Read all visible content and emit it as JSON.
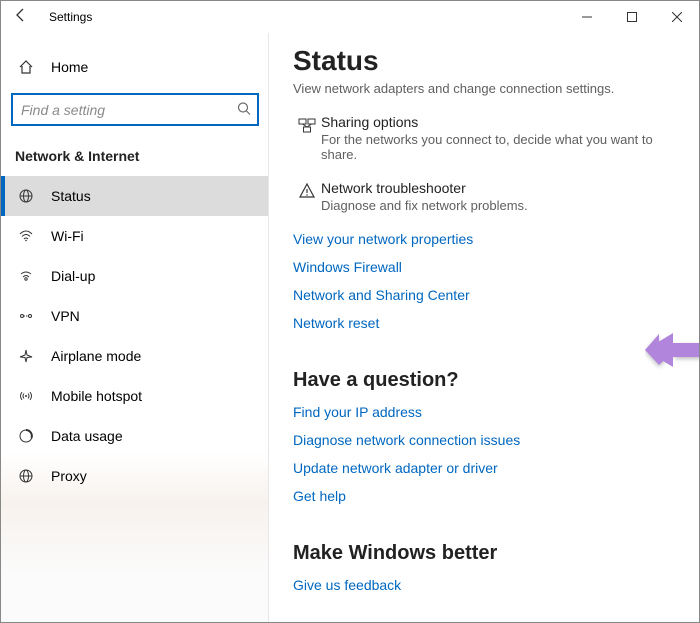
{
  "window": {
    "title": "Settings"
  },
  "sidebar": {
    "home": "Home",
    "search_placeholder": "Find a setting",
    "section": "Network & Internet",
    "items": [
      {
        "label": "Status"
      },
      {
        "label": "Wi-Fi"
      },
      {
        "label": "Dial-up"
      },
      {
        "label": "VPN"
      },
      {
        "label": "Airplane mode"
      },
      {
        "label": "Mobile hotspot"
      },
      {
        "label": "Data usage"
      },
      {
        "label": "Proxy"
      }
    ]
  },
  "content": {
    "title": "Status",
    "faded_line": "View network adapters and change connection settings.",
    "items": [
      {
        "title": "Sharing options",
        "desc": "For the networks you connect to, decide what you want to share."
      },
      {
        "title": "Network troubleshooter",
        "desc": "Diagnose and fix network problems."
      }
    ],
    "links": [
      "View your network properties",
      "Windows Firewall",
      "Network and Sharing Center",
      "Network reset"
    ],
    "question_hdr": "Have a question?",
    "question_links": [
      "Find your IP address",
      "Diagnose network connection issues",
      "Update network adapter or driver",
      "Get help"
    ],
    "better_hdr": "Make Windows better",
    "better_links": [
      "Give us feedback"
    ]
  }
}
